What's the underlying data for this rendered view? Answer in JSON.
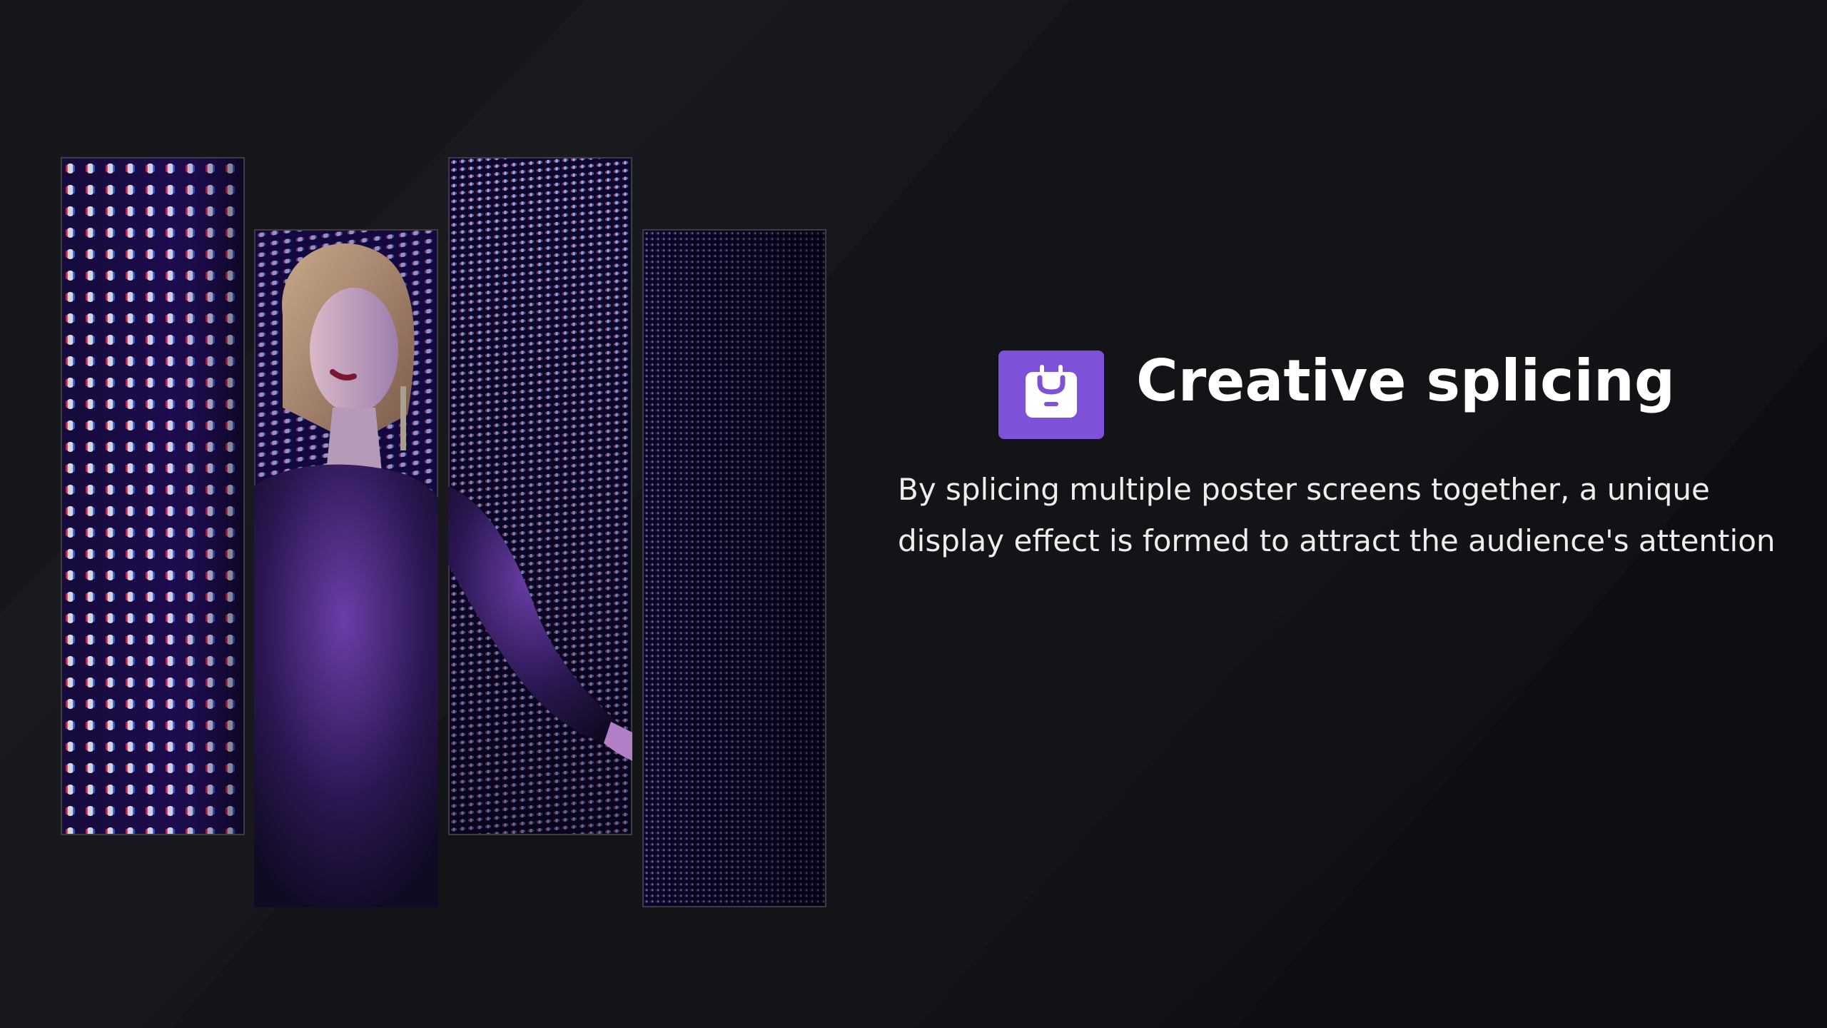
{
  "feature": {
    "icon": "shopping-bag-icon",
    "title": "Creative splicing",
    "description": "By splicing multiple poster screens together, a unique display effect is formed to attract the audience's attention"
  },
  "colors": {
    "background": "#101115",
    "accent": "#7d52d8",
    "title": "#ffffff",
    "text": "#eeeeee"
  },
  "panels": [
    {
      "name": "led-wall-panel-1"
    },
    {
      "name": "led-wall-panel-2"
    },
    {
      "name": "led-wall-panel-3"
    },
    {
      "name": "led-wall-panel-4"
    }
  ]
}
